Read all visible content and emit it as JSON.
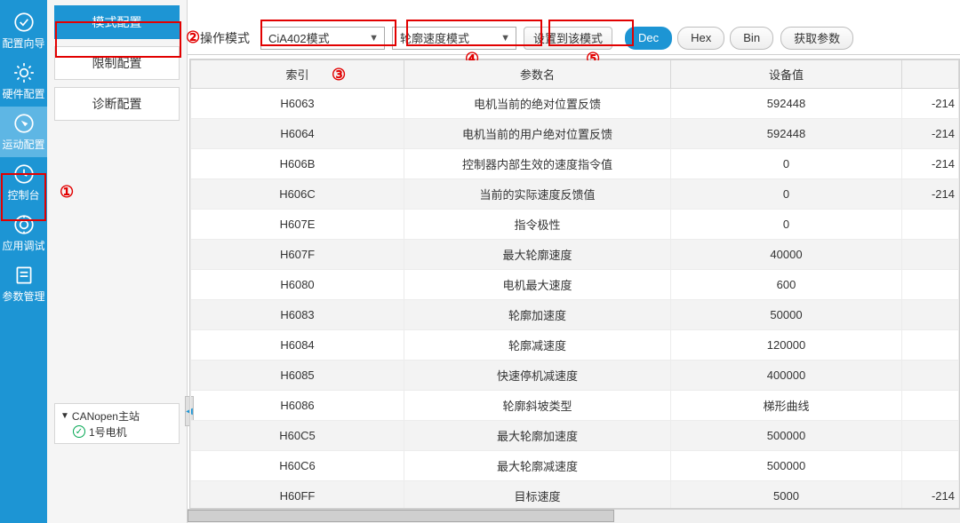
{
  "rail": [
    {
      "label": "配置向导",
      "id": "wizard"
    },
    {
      "label": "硬件配置",
      "id": "hardware"
    },
    {
      "label": "运动配置",
      "id": "motion"
    },
    {
      "label": "控制台",
      "id": "console"
    },
    {
      "label": "应用调试",
      "id": "debug"
    },
    {
      "label": "参数管理",
      "id": "params"
    }
  ],
  "rail_selected": 2,
  "nav": {
    "items": [
      {
        "label": "模式配置",
        "active": true
      },
      {
        "label": "限制配置",
        "active": false
      },
      {
        "label": "诊断配置",
        "active": false
      }
    ]
  },
  "tree": {
    "root": "CANopen主站",
    "children": [
      {
        "label": "1号电机",
        "ok": true
      }
    ]
  },
  "toolbar": {
    "mode_label": "操作模式",
    "mode_select": "CiA402模式",
    "sub_select": "轮廓速度模式",
    "set_btn": "设置到该模式",
    "radix": [
      {
        "label": "Dec",
        "active": true
      },
      {
        "label": "Hex",
        "active": false
      },
      {
        "label": "Bin",
        "active": false
      }
    ],
    "get_btn": "获取参数"
  },
  "table": {
    "headers": [
      "索引",
      "参数名",
      "设备值",
      ""
    ],
    "rows": [
      [
        "H6063",
        "电机当前的绝对位置反馈",
        "592448",
        "-214"
      ],
      [
        "H6064",
        "电机当前的用户绝对位置反馈",
        "592448",
        "-214"
      ],
      [
        "H606B",
        "控制器内部生效的速度指令值",
        "0",
        "-214"
      ],
      [
        "H606C",
        "当前的实际速度反馈值",
        "0",
        "-214"
      ],
      [
        "H607E",
        "指令极性",
        "0",
        ""
      ],
      [
        "H607F",
        "最大轮廓速度",
        "40000",
        ""
      ],
      [
        "H6080",
        "电机最大速度",
        "600",
        ""
      ],
      [
        "H6083",
        "轮廓加速度",
        "50000",
        ""
      ],
      [
        "H6084",
        "轮廓减速度",
        "120000",
        ""
      ],
      [
        "H6085",
        "快速停机减速度",
        "400000",
        ""
      ],
      [
        "H6086",
        "轮廓斜坡类型",
        "梯形曲线",
        ""
      ],
      [
        "H60C5",
        "最大轮廓加速度",
        "500000",
        ""
      ],
      [
        "H60C6",
        "最大轮廓减速度",
        "500000",
        ""
      ],
      [
        "H60FF",
        "目标速度",
        "5000",
        "-214"
      ]
    ]
  },
  "markers": {
    "m1": "①",
    "m2": "②",
    "m3": "③",
    "m4": "④",
    "m5": "⑤"
  }
}
